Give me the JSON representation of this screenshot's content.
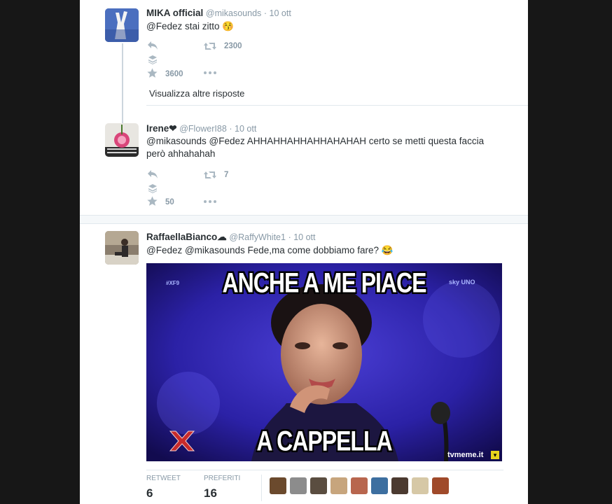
{
  "tweets": [
    {
      "name": "MIKA official",
      "handle": "@mikasounds",
      "time": "· 10 ott",
      "text": "@Fedez stai zitto 😚",
      "retweets": "2300",
      "favorites": "3600"
    },
    {
      "name": "Irene❤",
      "handle": "@FlowerI88",
      "time": "· 10 ott",
      "text": "@mikasounds @Fedez AHHAHHAHHAHHAHAHAH certo se metti questa faccia però ahhahahah",
      "retweets": "7",
      "favorites": "50"
    },
    {
      "name": "RaffaellaBianco☁",
      "handle": "@RaffyWhite1",
      "time": "· 10 ott",
      "text": "@Fedez @mikasounds Fede,ma come dobbiamo fare? 😂"
    }
  ],
  "more_replies": "Visualizza altre risposte",
  "meme": {
    "top_text": "ANCHE A ME PIACE",
    "bottom_text": "A CAPPELLA",
    "tag_left": "#XF9",
    "tag_right": "sky UNO",
    "watermark": "tvmeme.it"
  },
  "stats": {
    "retweet_label": "RETWEET",
    "retweet_value": "6",
    "favorites_label": "PREFERITI",
    "favorites_value": "16"
  },
  "colors": {
    "text": "#292f33",
    "muted": "#8899a6",
    "icon": "#aab8c2",
    "backdrop": "#171717"
  }
}
